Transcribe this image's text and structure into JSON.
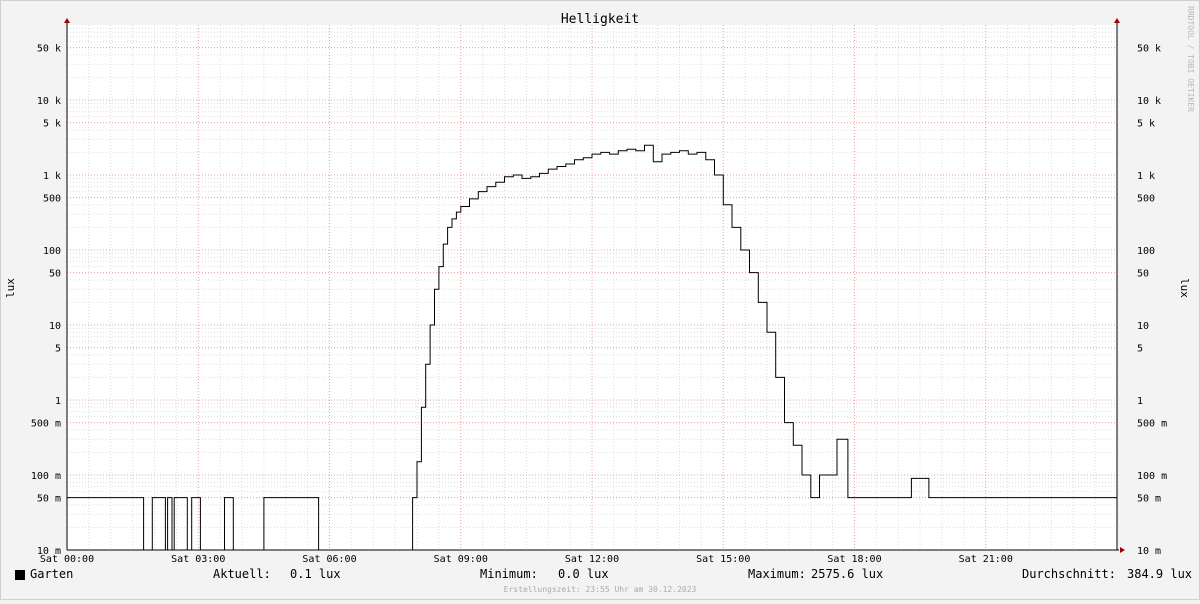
{
  "chart_data": {
    "type": "line",
    "title": "Helligkeit",
    "ylabel": "lux",
    "ylabel_right": "lux",
    "y_scale": "log",
    "ylim": [
      0.01,
      100000
    ],
    "grid": true,
    "x_ticks": [
      {
        "hour": 0,
        "label": "Sat 00:00"
      },
      {
        "hour": 3,
        "label": "Sat 03:00"
      },
      {
        "hour": 6,
        "label": "Sat 06:00"
      },
      {
        "hour": 9,
        "label": "Sat 09:00"
      },
      {
        "hour": 12,
        "label": "Sat 12:00"
      },
      {
        "hour": 15,
        "label": "Sat 15:00"
      },
      {
        "hour": 18,
        "label": "Sat 18:00"
      },
      {
        "hour": 21,
        "label": "Sat 21:00"
      }
    ],
    "y_ticks": [
      {
        "value": 0.01,
        "label": "10 m"
      },
      {
        "value": 0.05,
        "label": "50 m"
      },
      {
        "value": 0.1,
        "label": "100 m"
      },
      {
        "value": 0.5,
        "label": "500 m"
      },
      {
        "value": 1,
        "label": "1"
      },
      {
        "value": 5,
        "label": "5"
      },
      {
        "value": 10,
        "label": "10"
      },
      {
        "value": 50,
        "label": "50"
      },
      {
        "value": 100,
        "label": "100"
      },
      {
        "value": 500,
        "label": "500"
      },
      {
        "value": 1000,
        "label": "1 k"
      },
      {
        "value": 5000,
        "label": "5 k"
      },
      {
        "value": 10000,
        "label": "10 k"
      },
      {
        "value": 50000,
        "label": "50 k"
      }
    ],
    "series": [
      {
        "name": "Garten",
        "color": "#000000",
        "x_hours": [
          0,
          1.7,
          1.75,
          1.95,
          2.25,
          2.3,
          2.4,
          2.45,
          2.75,
          2.85,
          3.05,
          3.6,
          3.8,
          4.5,
          5.05,
          5.75,
          7.7,
          7.9,
          8.0,
          8.1,
          8.2,
          8.3,
          8.4,
          8.5,
          8.6,
          8.7,
          8.8,
          8.9,
          9.0,
          9.2,
          9.4,
          9.6,
          9.8,
          10.0,
          10.2,
          10.4,
          10.6,
          10.8,
          11.0,
          11.2,
          11.4,
          11.6,
          11.8,
          12.0,
          12.2,
          12.4,
          12.6,
          12.8,
          13.0,
          13.2,
          13.4,
          13.6,
          13.8,
          14.0,
          14.2,
          14.4,
          14.6,
          14.8,
          15.0,
          15.2,
          15.4,
          15.6,
          15.8,
          16.0,
          16.2,
          16.4,
          16.6,
          16.8,
          17.0,
          17.2,
          17.4,
          17.5,
          17.6,
          17.7,
          17.85,
          18.0,
          18.2,
          18.3,
          18.5,
          18.7,
          18.9,
          19.3,
          19.7,
          20.1,
          20.5,
          20.9,
          21.3,
          21.7,
          22.1,
          22.5,
          22.9,
          23.3,
          23.7,
          24.0
        ],
        "values": [
          0.05,
          0.05,
          0.01,
          0.05,
          0.01,
          0.05,
          0.01,
          0.05,
          0.01,
          0.05,
          0.01,
          0.05,
          0.01,
          0.05,
          0.05,
          0.01,
          0.01,
          0.05,
          0.15,
          0.8,
          3,
          10,
          30,
          60,
          120,
          200,
          260,
          320,
          380,
          480,
          600,
          700,
          800,
          950,
          1000,
          900,
          950,
          1050,
          1200,
          1300,
          1400,
          1600,
          1700,
          1900,
          2000,
          1900,
          2100,
          2200,
          2100,
          2500,
          1500,
          1900,
          2000,
          2100,
          1900,
          2000,
          1600,
          1000,
          400,
          200,
          100,
          50,
          20,
          8,
          2,
          0.5,
          0.25,
          0.1,
          0.05,
          0.1,
          0.1,
          0.1,
          0.3,
          0.3,
          0.05,
          0.05,
          0.05,
          0.05,
          0.05,
          0.05,
          0.05,
          0.09,
          0.05,
          0.05,
          0.05,
          0.05,
          0.05,
          0.05,
          0.05,
          0.05,
          0.05,
          0.05,
          0.05,
          0.05
        ]
      }
    ]
  },
  "legend": {
    "series_name": "Garten",
    "current_label": "Aktuell:",
    "current_value": "0.1 lux",
    "min_label": "Minimum:",
    "min_value": "0.0 lux",
    "max_label": "Maximum:",
    "max_value": "2575.6 lux",
    "avg_label": "Durchschnitt:",
    "avg_value": "384.9 lux"
  },
  "footer": {
    "created": "Erstellungszeit: 23:55 Uhr am 30.12.2023"
  },
  "watermark": "RRDTOOL / TOBI OETIKER"
}
